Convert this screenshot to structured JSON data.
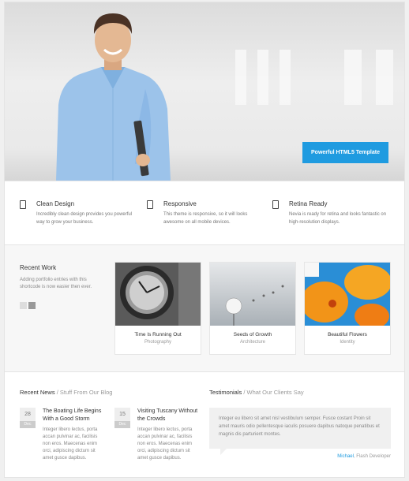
{
  "hero": {
    "button_label": "Powerful HTML5 Template"
  },
  "features": [
    {
      "title": "Clean Design",
      "text": "Incredibly clean design provides you powerful way to grow your business."
    },
    {
      "title": "Responsive",
      "text": "This theme is responsive, so it will looks awesome on all mobile devices."
    },
    {
      "title": "Retina Ready",
      "text": "Nevia is ready for retina and looks fantastic on high-resolution displays."
    }
  ],
  "recent_work": {
    "title": "Recent Work",
    "description": "Adding portfolio entries with this shortcode is now easier then ever.",
    "items": [
      {
        "title": "Time Is Running Out",
        "category": "Photography"
      },
      {
        "title": "Seeds of Growth",
        "category": "Architecture"
      },
      {
        "title": "Beautiful Flowers",
        "category": "Identity"
      }
    ]
  },
  "news": {
    "title": "Recent News",
    "subtitle": " / Stuff From Our Blog",
    "posts": [
      {
        "day": "28",
        "month": "Dec",
        "title": "The Boating Life Begins With a Good Storm",
        "excerpt": "Integer libero lectus, porta accan pulvinar ac, facilisis non eros. Maecenas enim orci, adipiscing dictum sit amet gusce dapibus."
      },
      {
        "day": "15",
        "month": "Dec",
        "title": "Visiting Tuscany Without the Crowds",
        "excerpt": "Integer libero lectus, porta accan pulvinar ac, facilisis non eros. Maecenas enim orci, adipiscing dictum sit amet gusce dapibus."
      }
    ]
  },
  "testimonials": {
    "title": "Testimonials",
    "subtitle": " / What Our Clients Say",
    "quote": "Integer eu libero sit amet nisl vestibulum semper. Fusce costant Proin sit amet mauris odio pellentesque iaculis posuere dapibus natoque penatibus et magnis dis parturient montes.",
    "author": "Michael",
    "role": ", Flash Developer"
  },
  "colors": {
    "accent": "#1f9be0"
  }
}
